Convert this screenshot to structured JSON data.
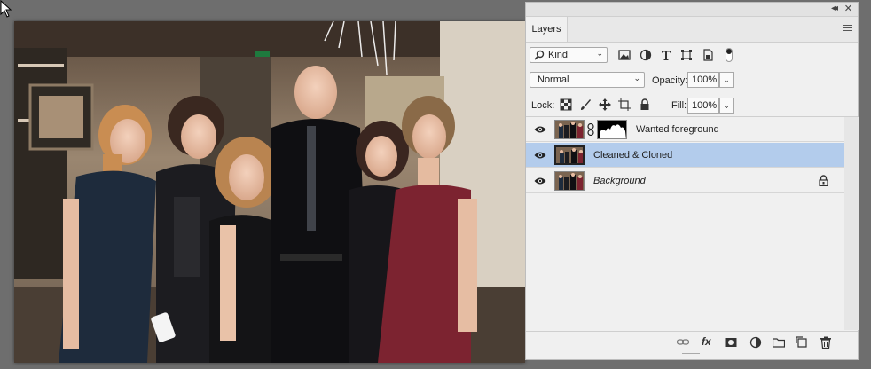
{
  "panel": {
    "tab_label": "Layers",
    "collapse_glyph": "◂◂",
    "close_glyph": "✕",
    "filter": {
      "kind_label": "Kind"
    },
    "blend_mode": "Normal",
    "opacity_label": "Opacity:",
    "opacity_value": "100%",
    "lock_label": "Lock:",
    "fill_label": "Fill:",
    "fill_value": "100%",
    "layers": [
      {
        "name": "Wanted foreground",
        "visible": true,
        "has_mask": true,
        "selected": false,
        "locked": false,
        "italic": false
      },
      {
        "name": "Cleaned & Cloned",
        "visible": true,
        "has_mask": false,
        "selected": true,
        "locked": false,
        "italic": false
      },
      {
        "name": "Background",
        "visible": true,
        "has_mask": false,
        "selected": false,
        "locked": true,
        "italic": true
      }
    ],
    "footer": {
      "fx_label": "fx"
    }
  },
  "colors": {
    "selection": "#b3ccec",
    "panel_bg": "#f0f0f0",
    "workspace_bg": "#6e6e6e"
  }
}
